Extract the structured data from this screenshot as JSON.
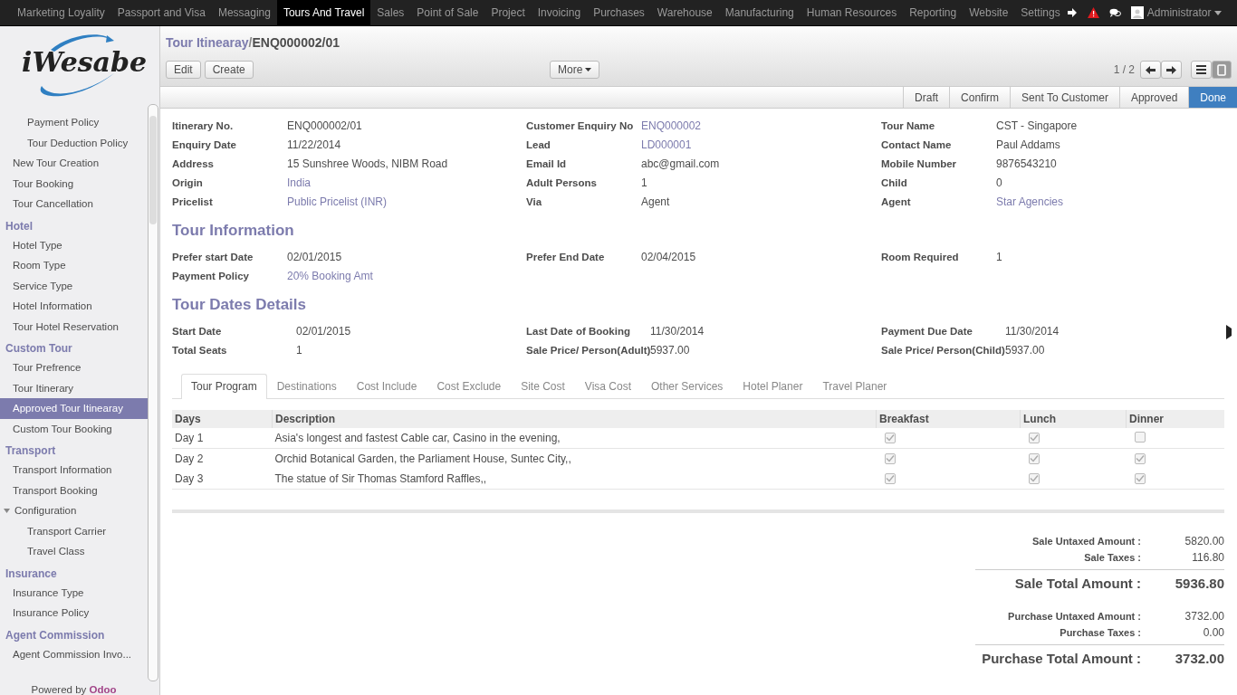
{
  "top_menu": [
    {
      "label": "Marketing Loyality",
      "selected": false
    },
    {
      "label": "Passport and Visa",
      "selected": false
    },
    {
      "label": "Messaging",
      "selected": false
    },
    {
      "label": "Tours And Travel",
      "selected": true
    },
    {
      "label": "Sales",
      "selected": false
    },
    {
      "label": "Point of Sale",
      "selected": false
    },
    {
      "label": "Project",
      "selected": false
    },
    {
      "label": "Invoicing",
      "selected": false
    },
    {
      "label": "Purchases",
      "selected": false
    },
    {
      "label": "Warehouse",
      "selected": false
    },
    {
      "label": "Manufacturing",
      "selected": false
    },
    {
      "label": "Human Resources",
      "selected": false
    },
    {
      "label": "Reporting",
      "selected": false
    },
    {
      "label": "Website",
      "selected": false
    },
    {
      "label": "Settings",
      "selected": false
    }
  ],
  "user": {
    "name": "Administrator"
  },
  "logo": {
    "text": "iWesabe"
  },
  "sidebar": {
    "sections": [
      {
        "items": [
          {
            "children": [
              {
                "label": "Payment Policy",
                "selected": false
              },
              {
                "label": "Tour Deduction Policy",
                "selected": false
              }
            ]
          },
          {
            "label": "New Tour Creation",
            "selected": false
          },
          {
            "label": "Tour Booking",
            "selected": false
          },
          {
            "label": "Tour Cancellation",
            "selected": false
          }
        ]
      },
      {
        "title": "Hotel",
        "items": [
          {
            "label": "Hotel Type",
            "selected": false
          },
          {
            "label": "Room Type",
            "selected": false
          },
          {
            "label": "Service Type",
            "selected": false
          },
          {
            "label": "Hotel Information",
            "selected": false
          },
          {
            "label": "Tour Hotel Reservation",
            "selected": false
          }
        ]
      },
      {
        "title": "Custom Tour",
        "items": [
          {
            "label": "Tour Prefrence",
            "selected": false
          },
          {
            "label": "Tour Itinerary",
            "selected": false
          },
          {
            "label": "Approved Tour Itinearay",
            "selected": true
          },
          {
            "label": "Custom Tour Booking",
            "selected": false
          }
        ]
      },
      {
        "title": "Transport",
        "items": [
          {
            "label": "Transport Information",
            "selected": false
          },
          {
            "label": "Transport Booking",
            "selected": false
          },
          {
            "label": "Configuration",
            "selected": false,
            "expanded": true,
            "children": [
              {
                "label": "Transport Carrier",
                "selected": false
              },
              {
                "label": "Travel Class",
                "selected": false
              }
            ]
          }
        ]
      },
      {
        "title": "Insurance",
        "items": [
          {
            "label": "Insurance Type",
            "selected": false
          },
          {
            "label": "Insurance Policy",
            "selected": false
          }
        ]
      },
      {
        "title": "Agent Commission",
        "items": [
          {
            "label": "Agent Commission Invo...",
            "selected": false
          }
        ]
      }
    ],
    "powered_by": {
      "text": "Powered by",
      "brand": "Odoo"
    }
  },
  "breadcrumb": {
    "parent": "Tour Itinearay",
    "separator": "/",
    "current": "ENQ000002/01"
  },
  "buttons": [
    "Edit",
    "Create"
  ],
  "more_button": "More",
  "pager": "1 / 2",
  "views": [
    {
      "kind": "list",
      "selected": false
    },
    {
      "kind": "form",
      "selected": true
    }
  ],
  "stages": [
    {
      "label": "Draft",
      "selected": false
    },
    {
      "label": "Confirm",
      "selected": false
    },
    {
      "label": "Sent To Customer",
      "selected": false
    },
    {
      "label": "Approved",
      "selected": false
    },
    {
      "label": "Done",
      "selected": true
    }
  ],
  "header_fields": [
    [
      {
        "label": "Itinerary No.",
        "value": "ENQ000002/01",
        "link": false
      },
      {
        "label": "Enquiry Date",
        "value": "11/22/2014",
        "link": false
      },
      {
        "label": "Address",
        "value": "15 Sunshree Woods, NIBM Road",
        "link": false
      },
      {
        "label": "Origin",
        "value": "India",
        "link": true
      },
      {
        "label": "Pricelist",
        "value": "Public Pricelist (INR)",
        "link": true
      }
    ],
    [
      {
        "label": "Customer Enquiry No",
        "value": "ENQ000002",
        "link": true
      },
      {
        "label": "Lead",
        "value": "LD000001",
        "link": true
      },
      {
        "label": "Email Id",
        "value": "abc@gmail.com",
        "link": false
      },
      {
        "label": "Adult Persons",
        "value": "1",
        "link": false
      },
      {
        "label": "Via",
        "value": "Agent",
        "link": false
      }
    ],
    [
      {
        "label": "Tour Name",
        "value": "CST - Singapore",
        "link": false
      },
      {
        "label": "Contact Name",
        "value": "Paul Addams",
        "link": false
      },
      {
        "label": "Mobile Number",
        "value": "9876543210",
        "link": false
      },
      {
        "label": "Child",
        "value": "0",
        "link": false
      },
      {
        "label": "Agent",
        "value": "Star Agencies",
        "link": true
      }
    ]
  ],
  "sections": [
    {
      "title": "Tour Information",
      "columns": [
        [
          {
            "label": "Prefer start Date",
            "value": "02/01/2015",
            "link": false
          },
          {
            "label": "Payment Policy",
            "value": "20% Booking Amt",
            "link": true
          }
        ],
        [
          {
            "label": "Prefer End Date",
            "value": "02/04/2015",
            "link": false
          }
        ],
        [
          {
            "label": "Room Required",
            "value": "1",
            "link": false
          }
        ]
      ]
    },
    {
      "title": "Tour Dates Details",
      "columns": [
        [
          {
            "label": "Start Date",
            "value": "02/01/2015",
            "link": false
          },
          {
            "label": "Total Seats",
            "value": "1",
            "link": false
          }
        ],
        [
          {
            "label": "Last Date of Booking",
            "value": "11/30/2014",
            "link": false
          },
          {
            "label": "Sale Price/ Person(Adult)",
            "value": "5937.00",
            "link": false
          }
        ],
        [
          {
            "label": "Payment Due Date",
            "value": "11/30/2014",
            "link": false
          },
          {
            "label": "Sale Price/ Person(Child)",
            "value": "5937.00",
            "link": false
          }
        ]
      ]
    }
  ],
  "tabs": [
    {
      "label": "Tour Program",
      "selected": true
    },
    {
      "label": "Destinations",
      "selected": false
    },
    {
      "label": "Cost Include",
      "selected": false
    },
    {
      "label": "Cost Exclude",
      "selected": false
    },
    {
      "label": "Site Cost",
      "selected": false
    },
    {
      "label": "Visa Cost",
      "selected": false
    },
    {
      "label": "Other Services",
      "selected": false
    },
    {
      "label": "Hotel Planer",
      "selected": false
    },
    {
      "label": "Travel Planer",
      "selected": false
    }
  ],
  "table": {
    "columns": [
      "Days",
      "Description",
      "Breakfast",
      "Lunch",
      "Dinner"
    ],
    "rows": [
      {
        "day": "Day 1",
        "description": "Asia's longest and fastest Cable car, Casino in the evening,",
        "breakfast": true,
        "lunch": true,
        "dinner": false
      },
      {
        "day": "Day 2",
        "description": "Orchid Botanical Garden, the Parliament House, Suntec City,,",
        "breakfast": true,
        "lunch": true,
        "dinner": true
      },
      {
        "day": "Day 3",
        "description": "The statue of Sir Thomas Stamford Raffles,,",
        "breakfast": true,
        "lunch": true,
        "dinner": true
      }
    ]
  },
  "totals": [
    {
      "kind": "line",
      "label": "Sale Untaxed Amount :",
      "value": "5820.00"
    },
    {
      "kind": "line",
      "label": "Sale Taxes :",
      "value": "116.80"
    },
    {
      "kind": "total",
      "label": "Sale Total Amount :",
      "value": "5936.80"
    },
    {
      "kind": "line",
      "label": "Purchase Untaxed Amount :",
      "value": "3732.00"
    },
    {
      "kind": "line",
      "label": "Purchase Taxes :",
      "value": "0.00"
    },
    {
      "kind": "total",
      "label": "Purchase Total Amount :",
      "value": "3732.00"
    }
  ]
}
